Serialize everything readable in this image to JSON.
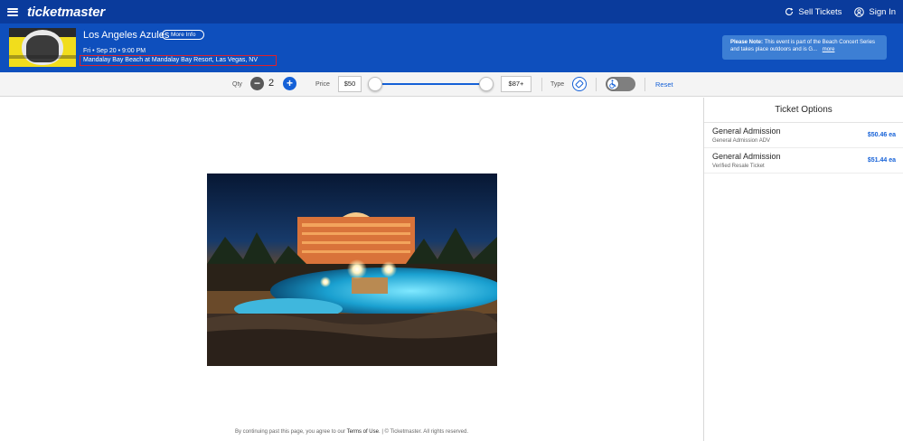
{
  "nav": {
    "brand": "ticketmaster",
    "sell_tickets": "Sell Tickets",
    "sign_in": "Sign In"
  },
  "event": {
    "title": "Los Angeles Azules",
    "more_info": "More Info",
    "date": "Fri • Sep 20 • 9:00 PM",
    "venue": "Mandalay Bay Beach at Mandalay Bay Resort, Las Vegas, NV",
    "note_label": "Please Note:",
    "note_text": "This event is part of the Beach Concert Series and takes place outdoors and is G...",
    "note_more": "more"
  },
  "filters": {
    "qty_label": "Qty",
    "qty_value": "2",
    "price_label": "Price",
    "price_min": "$50",
    "price_max": "$87+",
    "type_label": "Type",
    "reset": "Reset"
  },
  "footer": {
    "prefix": "By continuing past this page, you agree to our",
    "terms": "Terms of Use",
    "suffix": ". | © Ticketmaster. All rights reserved."
  },
  "panel": {
    "title": "Ticket Options",
    "tickets": [
      {
        "name": "General Admission",
        "sub": "General Admission ADV",
        "price": "$50.46 ea"
      },
      {
        "name": "General Admission",
        "sub": "Verified Resale Ticket",
        "price": "$51.44 ea"
      }
    ]
  },
  "colors": {
    "nav_bg": "#0a3b9c",
    "header_bg": "#0e4fbd",
    "accent": "#1561d7",
    "highlight_box": "#e0202b"
  }
}
